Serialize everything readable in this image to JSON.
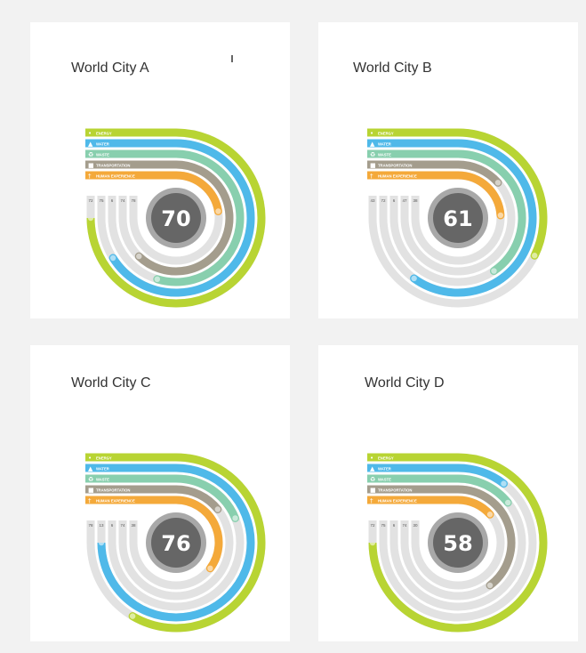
{
  "chart_data": [
    {
      "type": "radial-bar",
      "title": "World City A",
      "score": "70",
      "categories": [
        "ENERGY",
        "WATER",
        "WASTE",
        "TRANSPORTATION",
        "HUMAN EXPERIENCE"
      ],
      "series": [
        {
          "name": "ENERGY",
          "value": 100,
          "label": ""
        },
        {
          "name": "WATER",
          "value": 88,
          "label": ""
        },
        {
          "name": "WASTE",
          "value": 73,
          "label": ""
        },
        {
          "name": "TRANSPORTATION",
          "value": 83,
          "label": ""
        },
        {
          "name": "HUMAN EXPERIENCE",
          "value": 30,
          "label": ""
        }
      ],
      "stack_labels": [
        "72",
        "75",
        "6",
        "74",
        "78"
      ]
    },
    {
      "type": "radial-bar",
      "title": "World City B",
      "score": "61",
      "categories": [
        "ENERGY",
        "WATER",
        "WASTE",
        "TRANSPORTATION",
        "HUMAN EXPERIENCE"
      ],
      "series": [
        {
          "name": "ENERGY",
          "value": 43,
          "label": ""
        },
        {
          "name": "WATER",
          "value": 80,
          "label": ""
        },
        {
          "name": "WASTE",
          "value": 54,
          "label": ""
        },
        {
          "name": "TRANSPORTATION",
          "value": 18,
          "label": ""
        },
        {
          "name": "HUMAN EXPERIENCE",
          "value": 32,
          "label": ""
        }
      ],
      "stack_labels": [
        "43",
        "72",
        "6",
        "47",
        "38"
      ]
    },
    {
      "type": "radial-bar",
      "title": "World City C",
      "score": "76",
      "categories": [
        "ENERGY",
        "WATER",
        "WASTE",
        "TRANSPORTATION",
        "HUMAN EXPERIENCE"
      ],
      "series": [
        {
          "name": "ENERGY",
          "value": 78,
          "label": ""
        },
        {
          "name": "WATER",
          "value": 100,
          "label": ""
        },
        {
          "name": "WASTE",
          "value": 25,
          "label": ""
        },
        {
          "name": "TRANSPORTATION",
          "value": 19,
          "label": ""
        },
        {
          "name": "HUMAN EXPERIENCE",
          "value": 47,
          "label": ""
        }
      ],
      "stack_labels": [
        "78",
        "13",
        "6",
        "74",
        "38"
      ]
    },
    {
      "type": "radial-bar",
      "title": "World City D",
      "score": "58",
      "categories": [
        "ENERGY",
        "WATER",
        "WASTE",
        "TRANSPORTATION",
        "HUMAN EXPERIENCE"
      ],
      "series": [
        {
          "name": "ENERGY",
          "value": 100,
          "label": ""
        },
        {
          "name": "WATER",
          "value": 14,
          "label": ""
        },
        {
          "name": "WASTE",
          "value": 19,
          "label": ""
        },
        {
          "name": "TRANSPORTATION",
          "value": 53,
          "label": ""
        },
        {
          "name": "HUMAN EXPERIENCE",
          "value": 18,
          "label": ""
        }
      ],
      "stack_labels": [
        "72",
        "75",
        "6",
        "74",
        "30"
      ]
    }
  ],
  "colors": {
    "energy": "#b8d433",
    "water": "#4fb9e9",
    "waste": "#88cfae",
    "transportation": "#a49d8d",
    "human_experience": "#f4a93a",
    "track": "#e2e2e2",
    "center_dark": "#666666",
    "center_light": "#a8a8a8"
  }
}
